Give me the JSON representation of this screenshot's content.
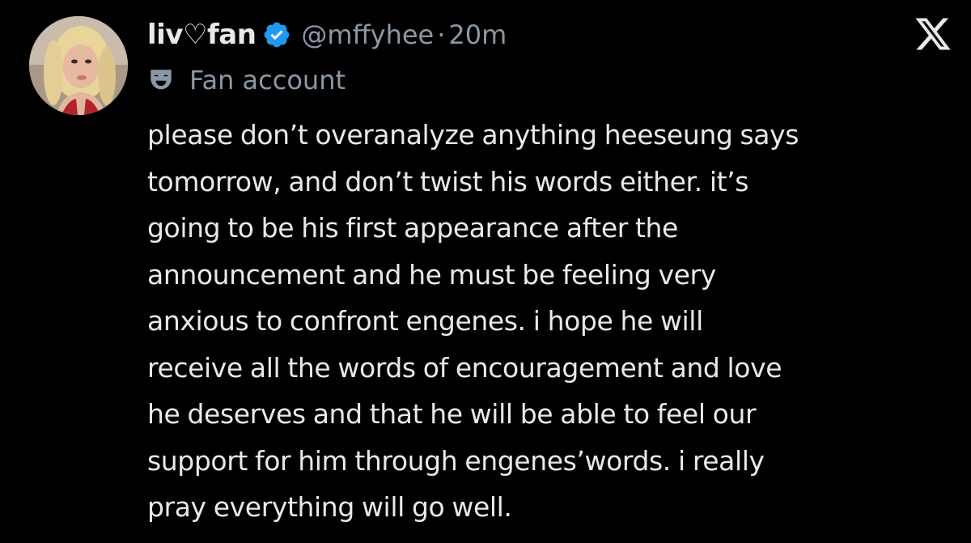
{
  "tweet": {
    "display_name": "liv♡fan",
    "handle": "@mffyhee",
    "separator": "·",
    "time": "20m",
    "label": "Fan account",
    "lines": [
      "please don’t overanalyze anything heeseung says",
      "tomorrow, and don’t twist his words either. it’s",
      "going to be his first appearance after the",
      "announcement and he must be feeling very",
      "anxious to confront engenes. i hope he will",
      "receive all the words of encouragement and love",
      "he deserves and that he will be able to feel our",
      "support for him through engenes’words. i really",
      "pray everything will go well."
    ]
  },
  "icons": {
    "verified": "verified-badge-icon",
    "label": "theater-mask-icon",
    "brand": "x-logo-icon",
    "avatar": "avatar-photo"
  },
  "colors": {
    "background": "#000000",
    "primary_text": "#e7e9ea",
    "secondary_text": "#8b98a5",
    "verified_blue": "#1d9bf0"
  }
}
